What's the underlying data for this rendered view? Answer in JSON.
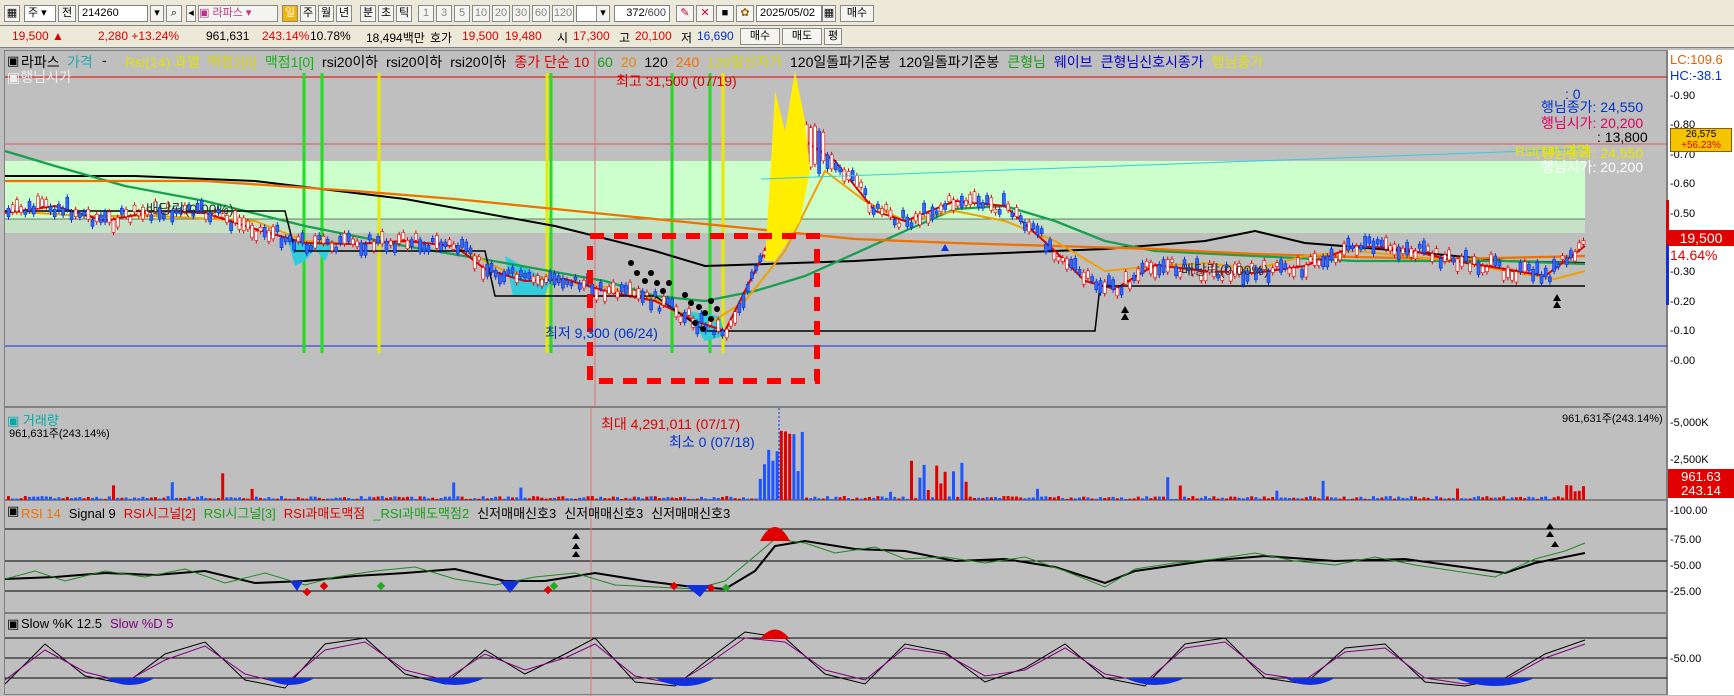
{
  "toolbar": {
    "period_sel": "주",
    "prev_btn": "전",
    "code": "214260",
    "stock_name": "라파스",
    "period_day": "일",
    "period_week": "주",
    "period_month": "월",
    "period_year": "년",
    "period_min": "분",
    "period_sec": "초",
    "period_tick": "틱",
    "intervals": [
      "1",
      "3",
      "5",
      "10",
      "20",
      "30",
      "60",
      "120"
    ],
    "count": "372",
    "count_total": "/600",
    "date": "2025/05/02",
    "buy": "매수",
    "sell": "매도",
    "avg": "평"
  },
  "quote": {
    "price": "19,500 ▲",
    "change": "2,280 +13.24%",
    "volume": "961,631",
    "vol_ratio": "243.14%",
    "turnover": "10.78%",
    "amount": "18,494백만",
    "hoga_label": "호가",
    "ask": "19,500",
    "bid": "19,480",
    "open_label": "시",
    "open": "17,300",
    "high_label": "고",
    "high": "20,100",
    "low_label": "저",
    "low": "16,690"
  },
  "price_legend": {
    "name": "라파스",
    "sub": "가격",
    "items": [
      {
        "text": "Rsi(14) 과열",
        "color": "#e3e300"
      },
      {
        "text": "맥점2[0]",
        "color": "#d7d700"
      },
      {
        "text": "맥점1[0]",
        "color": "#16b016"
      },
      {
        "text": "rsi20이하",
        "color": "#000"
      },
      {
        "text": "rsi20이하",
        "color": "#000"
      },
      {
        "text": "rsi20이하",
        "color": "#000"
      },
      {
        "text": "종가 단순 10",
        "color": "#e00000"
      },
      {
        "text": "60",
        "color": "#16a016"
      },
      {
        "text": "20",
        "color": "#f08000"
      },
      {
        "text": "120",
        "color": "#000"
      },
      {
        "text": "240",
        "color": "#f07000"
      },
      {
        "text": "120일신저가",
        "color": "#d7d700"
      },
      {
        "text": "120일돌파기준봉",
        "color": "#000"
      },
      {
        "text": "120일돌파기준봉",
        "color": "#000"
      },
      {
        "text": "큰형님",
        "color": "#16a016"
      },
      {
        "text": "웨이브",
        "color": "#0000cc"
      },
      {
        "text": "큰형님신호시종가",
        "color": "#0000cc"
      },
      {
        "text": "행님종가",
        "color": "#e3e300"
      }
    ],
    "line2": "행님시가"
  },
  "price_labels": {
    "high": "최고 31,500 (07/19)",
    "low": "최저 9,300 (06/24)",
    "dividend1": "배당락(0.00%)",
    "dividend2": "배당락(0.00%)",
    "zero": ": 0",
    "close_top": "행님종가: 24,550",
    "open_top": "행님시가: 20,200",
    "val13800": ": 13,800",
    "rsi_over": "Rsi(14) 과열",
    "close_bot": "행님종가: 24,550",
    "open_bot": "행님시가: 20,200"
  },
  "price_axis": {
    "lc": "LC:109.6",
    "hc": "HC:-38.1",
    "ticks": [
      "0.90",
      "0.80",
      "0.70",
      "0.60",
      "0.50",
      "0.40",
      "0.30",
      "0.20",
      "0.10",
      "0.00"
    ],
    "badge_price": "26,575",
    "badge_pct": "+56.23%",
    "cur_price": "19,500",
    "cur_pct": "14.64%"
  },
  "volume": {
    "title": "거래량",
    "value": "961,631주(243.14%)",
    "value_right": "961,631주(243.14%)",
    "max_label": "최대 4,291,011 (07/17)",
    "min_label": "최소 0 (07/18)",
    "ticks": [
      "5,000K",
      "2,500K"
    ],
    "cur": "961.63",
    "cur_pct": "243.14"
  },
  "rsi": {
    "legend": [
      {
        "text": "RSI 14",
        "color": "#f07000"
      },
      {
        "text": "Signal 9",
        "color": "#000"
      },
      {
        "text": "RSI시그널[2]",
        "color": "#e00000"
      },
      {
        "text": "RSI시그널[3]",
        "color": "#16a016"
      },
      {
        "text": "RSI과매도맥점",
        "color": "#e00000"
      },
      {
        "text": "_RSI과매도맥점2",
        "color": "#16a016"
      },
      {
        "text": "신저매매신호3",
        "color": "#000"
      },
      {
        "text": "신저매매신호3",
        "color": "#000"
      },
      {
        "text": "신저매매신호3",
        "color": "#000"
      }
    ],
    "ticks": [
      "100.00",
      "75.00",
      "50.00",
      "25.00"
    ]
  },
  "stoch": {
    "legend": [
      {
        "text": "Slow %K 12.5",
        "color": "#000"
      },
      {
        "text": "Slow %D 5",
        "color": "#800080"
      }
    ],
    "ticks": [
      "50.00"
    ]
  },
  "colors": {
    "bg": "#bfbfbf",
    "up": "#e00000",
    "down": "#0033cc",
    "green_zone": "#ccffcc",
    "accent": "#f4b400"
  }
}
